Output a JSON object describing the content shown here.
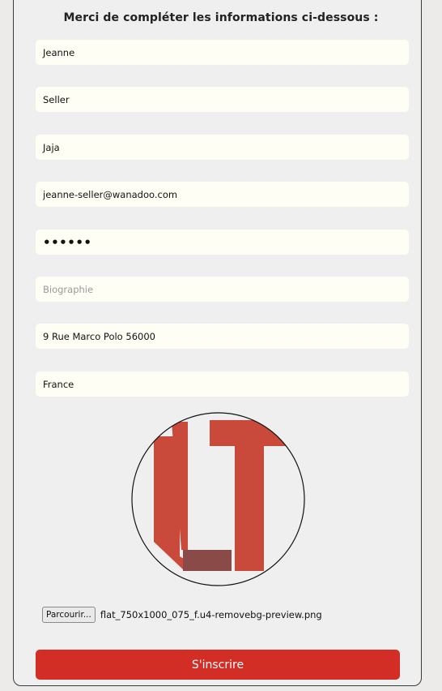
{
  "form": {
    "heading": "Merci de compléter les informations ci-dessous :",
    "first_name": "Jeanne",
    "last_name": "Seller",
    "username": "Jaja",
    "email": "jeanne-seller@wanadoo.com",
    "password": "••••••",
    "biography_placeholder": "Biographie",
    "address": "9 Rue Marco Polo 56000",
    "country": "France",
    "avatar_icon": "lt-logo",
    "file_button_label": "Parcourir...",
    "file_name": "flat_750x1000_075_f.u4-removebg-preview.png",
    "submit_label": "S'inscrire"
  },
  "colors": {
    "accent": "#d22e26",
    "logo_red": "#c94a3a",
    "logo_dark": "#8a4a48",
    "field_bg": "#fefef4"
  }
}
